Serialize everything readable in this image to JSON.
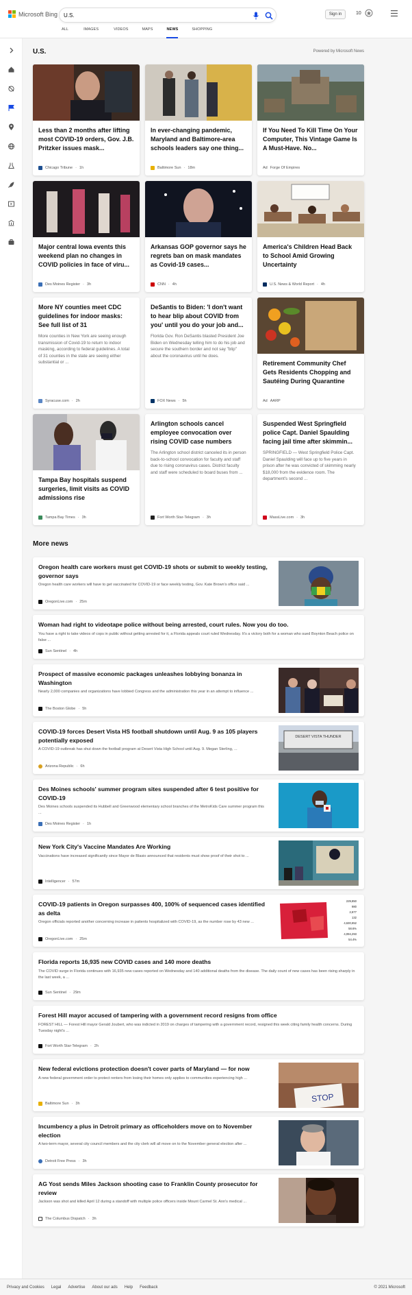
{
  "header": {
    "logo_text": "Microsoft Bing",
    "search_value": "U.S.",
    "signin_label": "Sign in",
    "rewards_count": "10",
    "tabs": [
      {
        "label": "ALL"
      },
      {
        "label": "IMAGES"
      },
      {
        "label": "VIDEOS"
      },
      {
        "label": "MAPS"
      },
      {
        "label": "NEWS",
        "active": true
      },
      {
        "label": "SHOPPING"
      }
    ]
  },
  "sidebar": {
    "icons": [
      "expand-icon",
      "home-icon",
      "sports-icon",
      "flag-icon",
      "location-icon",
      "globe-icon",
      "science-icon",
      "rocket-icon",
      "entertainment-icon",
      "money-icon",
      "politics-icon"
    ]
  },
  "main": {
    "section_title": "U.S.",
    "powered_by": "Powered by Microsoft News",
    "cards": [
      {
        "title": "Less than 2 months after lifting most COVID-19 orders, Gov. J.B. Pritzker issues mask...",
        "source": "Chicago Tribune",
        "time": "1h",
        "snippet": ""
      },
      {
        "title": "In ever-changing pandemic, Maryland and Baltimore-area schools leaders say one thing...",
        "source": "Baltimore Sun",
        "time": "18m",
        "snippet": ""
      },
      {
        "title": "If You Need To Kill Time On Your Computer, This Vintage Game Is A Must-Have. No...",
        "source": "Forge Of Empires",
        "time": "",
        "ad": "Ad",
        "snippet": ""
      },
      {
        "title": "Major central Iowa events this weekend plan no changes in COVID policies in face of viru...",
        "source": "Des Moines Register",
        "time": "3h",
        "snippet": ""
      },
      {
        "title": "Arkansas GOP governor says he regrets ban on mask mandates as Covid-19 cases...",
        "source": "CNN",
        "time": "4h",
        "snippet": ""
      },
      {
        "title": "America's Children Head Back to School Amid Growing Uncertainty",
        "source": "U.S. News & World Report",
        "time": "4h",
        "snippet": ""
      },
      {
        "title": "More NY counties meet CDC guidelines for indoor masks: See full list of 31",
        "source": "Syracuse.com",
        "time": "2h",
        "snippet": "More counties in New York are seeing enough transmission of Covid-19 to return to indoor masking, according to federal guidelines. A total of 31 counties in the state are seeing either substantial or ..."
      },
      {
        "title": "DeSantis to Biden: 'I don't want to hear blip about COVID from you' until you do your job and...",
        "source": "FOX News",
        "time": "5h",
        "snippet": "Florida Gov. Ron DeSantis blasted President Joe Biden on Wednesday telling him to do his job and secure the southern border and not say \"blip\" about the coronavirus until he does."
      },
      {
        "title": "Retirement Community Chef Gets Residents Chopping and Sautéing During Quarantine",
        "source": "AARP",
        "time": "",
        "ad": "Ad",
        "snippet": ""
      },
      {
        "title": "Tampa Bay hospitals suspend surgeries, limit visits as COVID admissions rise",
        "source": "Tampa Bay Times",
        "time": "3h",
        "snippet": ""
      },
      {
        "title": "Arlington schools cancel employee convocation over rising COVID case numbers",
        "source": "Fort Worth Star-Telegram",
        "time": "3h",
        "snippet": "The Arlington school district canceled its in person back-to-school convocation for faculty and staff due to rising coronavirus cases. District faculty and staff were scheduled to board buses from ..."
      },
      {
        "title": "Suspended West Springfield police Capt. Daniel Spaulding facing jail time after skimmin...",
        "source": "MassLive.com",
        "time": "3h",
        "snippet": "SPRINGFIELD — West Springfield Police Capt. Daniel Spaulding will face up to five years in prison after he was convicted of skimming nearly $18,000 from the evidence room. The department's second ..."
      }
    ],
    "more_title": "More news",
    "more_news": [
      {
        "title": "Oregon health care workers must get COVID-19 shots or submit to weekly testing, governor says",
        "snippet": "Oregon health care workers will have to get vaccinated for COVID-19 or face weekly testing, Gov. Kate Brown's office said ...",
        "source": "OregonLive.com",
        "time": "25m",
        "thumb": true
      },
      {
        "title": "Woman had right to videotape police without being arrested, court rules. Now you do too.",
        "snippet": "You have a right to take videos of cops in public without getting arrested for it, a Florida appeals court ruled Wednesday. It's a victory both for a woman who sued Boynton Beach police on false ...",
        "source": "Sun Sentinel",
        "time": "4h",
        "thumb": false
      },
      {
        "title": "Prospect of massive economic packages unleashes lobbying bonanza in Washington",
        "snippet": "Nearly 2,000 companies and organizations have lobbied Congress and the administration this year in an attempt to influence ...",
        "source": "The Boston Globe",
        "time": "5h",
        "thumb": true
      },
      {
        "title": "COVID-19 forces Desert Vista HS football shutdown until Aug. 9 as 105 players potentially exposed",
        "snippet": "A COVID-19 outbreak has shut down the football program at Desert Vista High School until Aug. 9. Megan Sterling, ...",
        "source": "Arizona Republic",
        "time": "6h",
        "thumb": true
      },
      {
        "title": "Des Moines schools' summer program sites suspended after 6 test positive for COVID-19",
        "snippet": "Des Moines schools suspended its Hubbell and Greenwood elementary school branches of the MetroKids Care summer program this ...",
        "source": "Des Moines Register",
        "time": "1h",
        "thumb": true
      },
      {
        "title": "New York City's Vaccine Mandates Are Working",
        "snippet": "Vaccinations have increased significantly since Mayor de Blasio announced that residents must show proof of their shot to ...",
        "source": "Intelligencer",
        "time": "57m",
        "thumb": true
      },
      {
        "title": "COVID-19 patients in Oregon surpasses 400, 100% of sequenced cases identified as delta",
        "snippet": "Oregon officials reported another concerning increase in patients hospitalized with COVID-19, as the number rose by 43 new ...",
        "source": "OregonLive.com",
        "time": "25m",
        "thumb": true
      },
      {
        "title": "Florida reports 16,935 new COVID cases and 140 more deaths",
        "snippet": "The COVID surge in Florida continues with 16,935 new cases reported on Wednesday and 140 additional deaths from the disease. The daily count of new cases has been rising sharply in the last week, a ...",
        "source": "Sun Sentinel",
        "time": "29m",
        "thumb": false
      },
      {
        "title": "Forest Hill mayor accused of tampering with a government record resigns from office",
        "snippet": "FOREST HILL — Forest Hill mayor Gerald Joubert, who was indicted in 2019 on charges of tampering with a government record, resigned this week citing family health concerns. During Tuesday night's ...",
        "source": "Fort Worth Star-Telegram",
        "time": "2h",
        "thumb": false
      },
      {
        "title": "New federal evictions protection doesn't cover parts of Maryland — for now",
        "snippet": "A new federal government order to protect renters from losing their homes only applies to communities experiencing high ...",
        "source": "Baltimore Sun",
        "time": "3h",
        "thumb": true
      },
      {
        "title": "Incumbency a plus in Detroit primary as officeholders move on to November election",
        "snippet": "A two-term mayor, several city council members and the city clerk will all move on to the November general election after ...",
        "source": "Detroit Free Press",
        "time": "3h",
        "thumb": true
      },
      {
        "title": "AG Yost sends Miles Jackson shooting case to Franklin County prosecutor for review",
        "snippet": "Jackson was shot and killed April 12 during a standoff with multiple police officers inside Mount Carmel St. Ann's medical ...",
        "source": "The Columbus Dispatch",
        "time": "3h",
        "thumb": true
      }
    ],
    "thumb_texts": {
      "desert_vista": "DESERT VISTA THUNDER",
      "stop_sign": "STOP",
      "oregon_stats": [
        "229,850",
        "980",
        "2,877",
        "132",
        "4,630,652",
        "58.6%",
        "4,094,293",
        "54.4%"
      ]
    }
  },
  "footer": {
    "links": [
      "Privacy and Cookies",
      "Legal",
      "Advertise",
      "About our ads",
      "Help",
      "Feedback"
    ],
    "copyright": "© 2021 Microsoft"
  },
  "colors": {
    "accent": "#174ae4",
    "link": "#1a0dab"
  }
}
